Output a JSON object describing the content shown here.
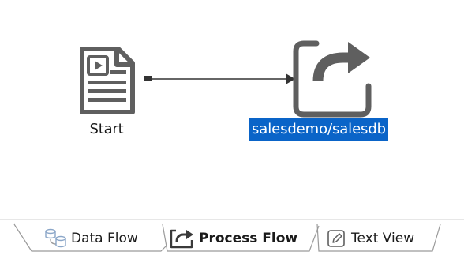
{
  "canvas": {
    "nodes": [
      {
        "label": "Start",
        "icon": "document-start-icon"
      },
      {
        "label": "salesdemo/salesdb",
        "icon": "redirect-arrow-icon",
        "selected": true
      }
    ],
    "selection_color": "#0a64c8"
  },
  "tabs": [
    {
      "label": "Data Flow",
      "icon": "data-flow-icon",
      "active": false
    },
    {
      "label": "Process Flow",
      "icon": "process-flow-icon",
      "active": true
    },
    {
      "label": "Text View",
      "icon": "text-view-icon",
      "active": false
    }
  ],
  "colors": {
    "icon_gray": "#5f5f5f",
    "connector": "#333333",
    "tab_border": "#9a9a9a"
  }
}
